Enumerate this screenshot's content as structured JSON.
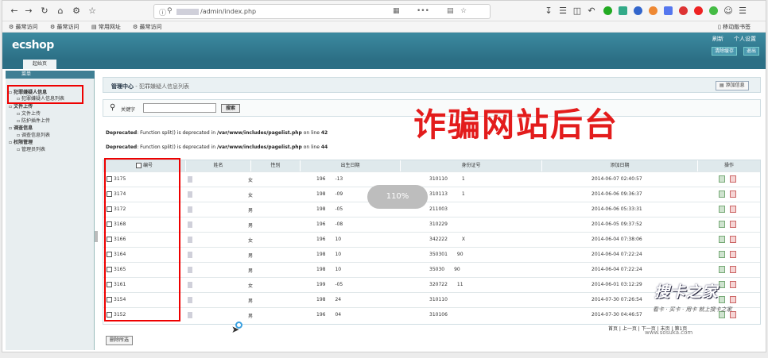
{
  "browser": {
    "url": "/admin/index.php",
    "bookmarks": [
      "最常访问",
      "最常访问",
      "常用网址",
      "最常访问"
    ],
    "mobile_bookmarks": "移动版书签",
    "menu_dots": "•••",
    "zoom_badge": "110%"
  },
  "header": {
    "logo": "ecshop",
    "links": [
      "刷新",
      "个人设置"
    ],
    "buttons": [
      "清除缓存",
      "退出"
    ]
  },
  "tab": {
    "label": "起始页"
  },
  "sidebar": {
    "head": "菜单",
    "items": [
      {
        "label": "犯罪嫌疑人信息",
        "cat": true
      },
      {
        "label": "犯罪嫌疑人信息列表",
        "cat": false
      },
      {
        "label": "文件上传",
        "cat": true
      },
      {
        "label": "文件上传",
        "cat": false
      },
      {
        "label": "防护插件上传",
        "cat": false
      },
      {
        "label": "调查信息",
        "cat": true
      },
      {
        "label": "调查信息列表",
        "cat": false
      },
      {
        "label": "权限管理",
        "cat": true
      },
      {
        "label": "管理员列表",
        "cat": false
      }
    ]
  },
  "main": {
    "title": "管理中心",
    "subtitle": " - 犯罪嫌疑人信息列表",
    "add_button": "添加信息",
    "search_label": "关键字",
    "search_button": "搜索",
    "deprecated": [
      {
        "prefix": "Deprecated",
        "text": ": Function split() is deprecated in ",
        "path": "/var/www/includes/pagelist.php",
        "online": " on line ",
        "line": "42"
      },
      {
        "prefix": "Deprecated",
        "text": ": Function split() is deprecated in ",
        "path": "/var/www/includes/pagelist.php",
        "online": " on line ",
        "line": "44"
      }
    ],
    "overlay_text": "诈骗网站后台",
    "columns": [
      "编号",
      "姓名",
      "性别",
      "出生日期",
      "身份证号",
      "添加日期",
      "操作"
    ],
    "rows": [
      {
        "id": "3175",
        "gender": "女",
        "birth": "196  -13",
        "idno": "310110   1",
        "added": "2014-06-07 02:40:57"
      },
      {
        "id": "3174",
        "gender": "女",
        "birth": "198  -09",
        "idno": "310113   1",
        "added": "2014-06-06 09:36:37"
      },
      {
        "id": "3172",
        "gender": "男",
        "birth": "198  -05",
        "idno": "211003   ",
        "added": "2014-06-06 05:33:31"
      },
      {
        "id": "3168",
        "gender": "男",
        "birth": "196  -08",
        "idno": "310229   ",
        "added": "2014-06-05 09:37:52"
      },
      {
        "id": "3166",
        "gender": "女",
        "birth": "196  10",
        "idno": "342222   X",
        "added": "2014-06-04 07:38:06"
      },
      {
        "id": "3164",
        "gender": "男",
        "birth": "198  10",
        "idno": "350301  90",
        "added": "2014-06-04 07:22:24"
      },
      {
        "id": "3165",
        "gender": "男",
        "birth": "198  10",
        "idno": "35030  90",
        "added": "2014-06-04 07:22:24"
      },
      {
        "id": "3161",
        "gender": "女",
        "birth": "199  -05",
        "idno": "320722  11",
        "added": "2014-06-01 03:12:29"
      },
      {
        "id": "3154",
        "gender": "男",
        "birth": "198  24",
        "idno": "310110   ",
        "added": "2014-07-30 07:26:54"
      },
      {
        "id": "3152",
        "gender": "男",
        "birth": "196  04",
        "idno": "310106   ",
        "added": "2014-07-30 04:46:57"
      }
    ],
    "pager": [
      "首页",
      "上一页",
      "下一页",
      "末页",
      "第1页"
    ],
    "delete_button": "删除所选"
  },
  "watermark": {
    "logo": "搜卡之家",
    "tagline": "看卡 · 买卡 · 用卡 就上搜卡之家",
    "url": "www.sosuka.com"
  }
}
